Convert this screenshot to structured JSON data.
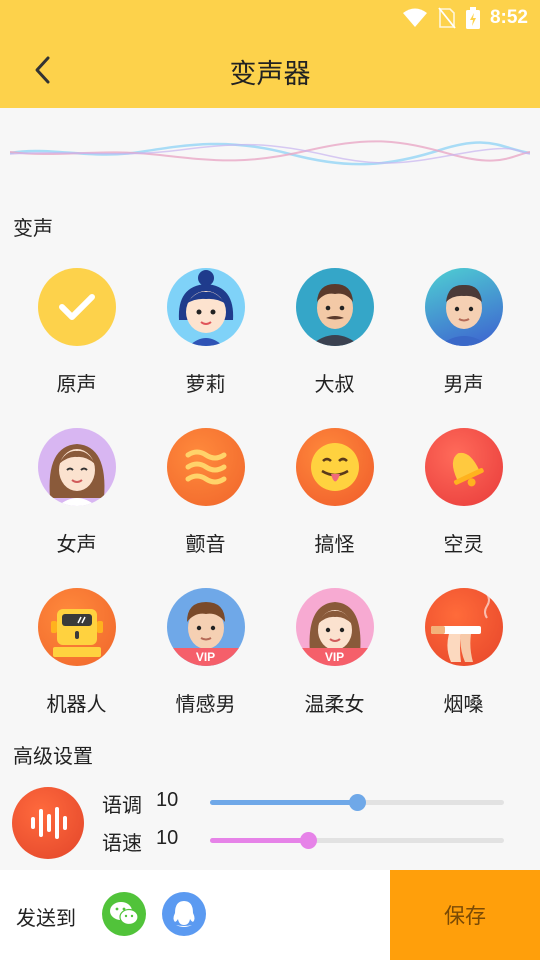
{
  "status_bar": {
    "time": "8:52"
  },
  "header": {
    "title": "变声器"
  },
  "voice_section": {
    "title": "变声",
    "items": [
      {
        "label": "原声",
        "icon": "checkmark-icon",
        "selected": true,
        "vip": ""
      },
      {
        "label": "萝莉",
        "icon": "girl-avatar-icon",
        "selected": false,
        "vip": ""
      },
      {
        "label": "大叔",
        "icon": "uncle-avatar-icon",
        "selected": false,
        "vip": ""
      },
      {
        "label": "男声",
        "icon": "man-avatar-icon",
        "selected": false,
        "vip": ""
      },
      {
        "label": "女声",
        "icon": "woman-avatar-icon",
        "selected": false,
        "vip": ""
      },
      {
        "label": "颤音",
        "icon": "wave-icon",
        "selected": false,
        "vip": ""
      },
      {
        "label": "搞怪",
        "icon": "funny-face-icon",
        "selected": false,
        "vip": ""
      },
      {
        "label": "空灵",
        "icon": "bell-icon",
        "selected": false,
        "vip": ""
      },
      {
        "label": "机器人",
        "icon": "robot-icon",
        "selected": false,
        "vip": ""
      },
      {
        "label": "情感男",
        "icon": "emotional-man-icon",
        "selected": false,
        "vip": "VIP"
      },
      {
        "label": "温柔女",
        "icon": "gentle-woman-icon",
        "selected": false,
        "vip": "VIP"
      },
      {
        "label": "烟嗓",
        "icon": "cigarette-icon",
        "selected": false,
        "vip": ""
      }
    ]
  },
  "advanced": {
    "title": "高级设置",
    "pitch": {
      "label": "语调",
      "value": "10",
      "fraction": 0.5,
      "color": "#6fa8e8"
    },
    "speed": {
      "label": "语速",
      "value": "10",
      "fraction": 0.335,
      "color": "#e683e8"
    }
  },
  "bottom": {
    "send_label": "发送到",
    "share_targets": [
      "wechat-icon",
      "qq-icon"
    ],
    "save_label": "保存"
  },
  "colors": {
    "accent": "#fdd24b",
    "save": "#ff9f0b",
    "wechat": "#51c33a",
    "qq": "#5b9af1"
  }
}
